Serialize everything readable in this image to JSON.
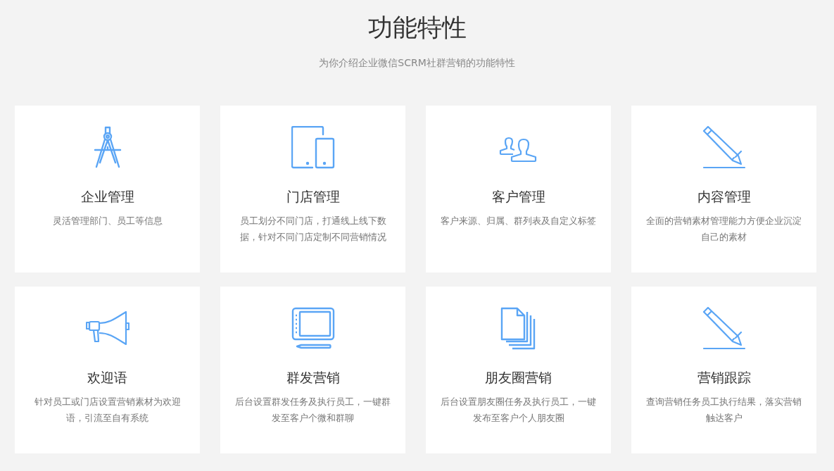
{
  "header": {
    "title": "功能特性",
    "subtitle": "为你介绍企业微信SCRM社群营销的功能特性"
  },
  "features": [
    {
      "kind": "compass",
      "title": "企业管理",
      "description": "灵活管理部门、员工等信息"
    },
    {
      "kind": "devices",
      "title": "门店管理",
      "description": "员工划分不同门店，打通线上线下数据，针对不同门店定制不同营销情况"
    },
    {
      "kind": "users",
      "title": "客户管理",
      "description": "客户来源、归属、群列表及自定义标签"
    },
    {
      "kind": "pencil",
      "title": "内容管理",
      "description": "全面的营销素材管理能力方便企业沉淀自己的素材"
    },
    {
      "kind": "megaphone",
      "title": "欢迎语",
      "description": "针对员工或门店设置营销素材为欢迎语，引流至自有系统"
    },
    {
      "kind": "tablet",
      "title": "群发营销",
      "description": "后台设置群发任务及执行员工，一键群发至客户个微和群聊"
    },
    {
      "kind": "documents",
      "title": "朋友圈营销",
      "description": "后台设置朋友圈任务及执行员工，一键发布至客户个人朋友圈"
    },
    {
      "kind": "pencil",
      "title": "营销跟踪",
      "description": "查询营销任务员工执行结果，落实营销触达客户"
    }
  ]
}
